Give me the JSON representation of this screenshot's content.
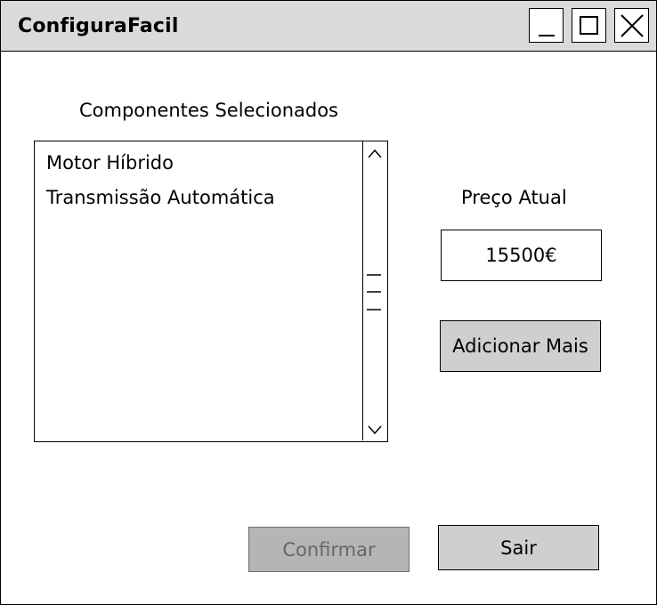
{
  "window": {
    "title": "ConfiguraFacil",
    "controls": [
      "minimize-icon",
      "maximize-icon",
      "close-icon"
    ]
  },
  "components": {
    "label": "Componentes Selecionados",
    "items": [
      {
        "label": "Motor Híbrido"
      },
      {
        "label": "Transmissão Automática"
      }
    ]
  },
  "price": {
    "label": "Preço Atual",
    "value": "15500€"
  },
  "buttons": {
    "add_more": "Adicionar Mais",
    "confirm": "Confirmar",
    "exit": "Sair"
  },
  "colors": {
    "titlebar_bg": "#dadada",
    "button_bg": "#cfcfcf",
    "disabled_button_bg": "#b5b5b5",
    "disabled_text": "#666666"
  }
}
